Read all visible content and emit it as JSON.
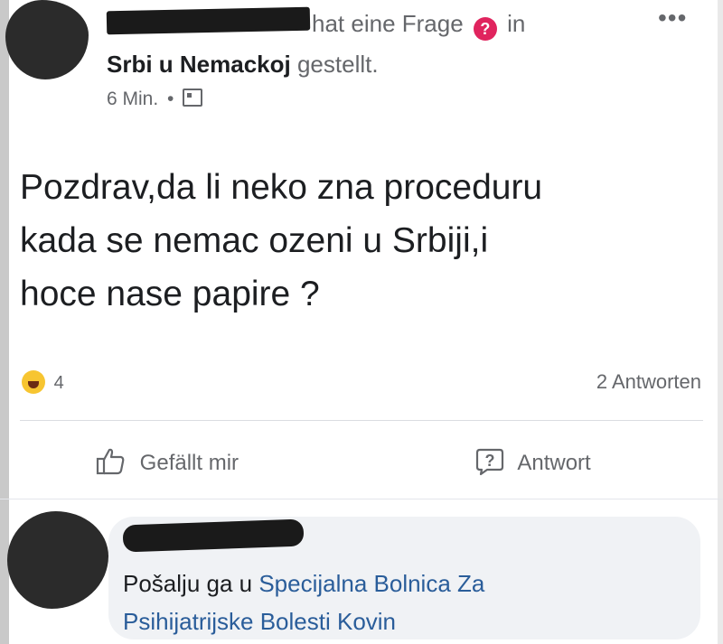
{
  "post": {
    "header": {
      "asked_text": "hat eine Frage",
      "frage_badge": "?",
      "in_text": "in",
      "group_name": "Srbi u Nemackoj",
      "posted_text": "gestellt.",
      "time": "6 Min.",
      "separator": "•",
      "audience_icon": "group-audience-icon",
      "more_label": "•••"
    },
    "text_lines": [
      "Pozdrav,da li neko zna proceduru",
      "kada se nemac ozeni u Srbiji,i",
      "hoce nase papire ?"
    ],
    "reactions": {
      "icon": "haha-emoji-icon",
      "count": "4"
    },
    "answers_count": "2 Antworten",
    "actions": {
      "like_label": "Gefällt mir",
      "answer_label": "Antwort"
    }
  },
  "comment": {
    "text_prefix": "Pošalju ga u ",
    "link_text_line1": "Specijalna Bolnica Za",
    "link_text_line2": "Psihijatrijske Bolesti Kovin",
    "link_color": "#2a5d9a"
  }
}
